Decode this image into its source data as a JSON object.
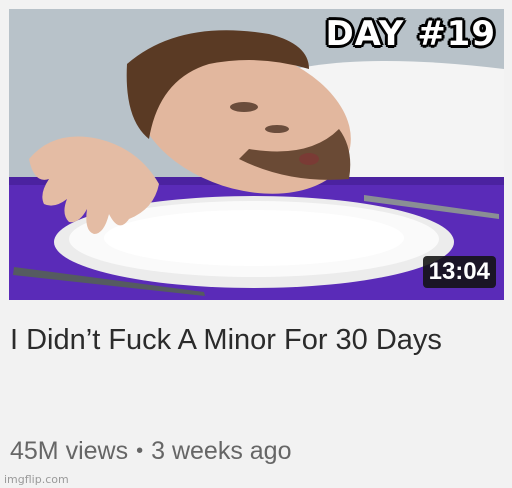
{
  "video": {
    "thumbnail_label": "DAY #19",
    "duration": "13:04",
    "title": "I Didn’t Fuck A Minor For 30 Days",
    "views": "45M views",
    "separator": "•",
    "uploaded": "3 weeks ago"
  },
  "watermark": "imgflip.com",
  "colors": {
    "tablecloth": "#5a2bb8",
    "background": "#f2f2f2",
    "title_text": "#2b2b2b",
    "meta_text": "#666666"
  }
}
